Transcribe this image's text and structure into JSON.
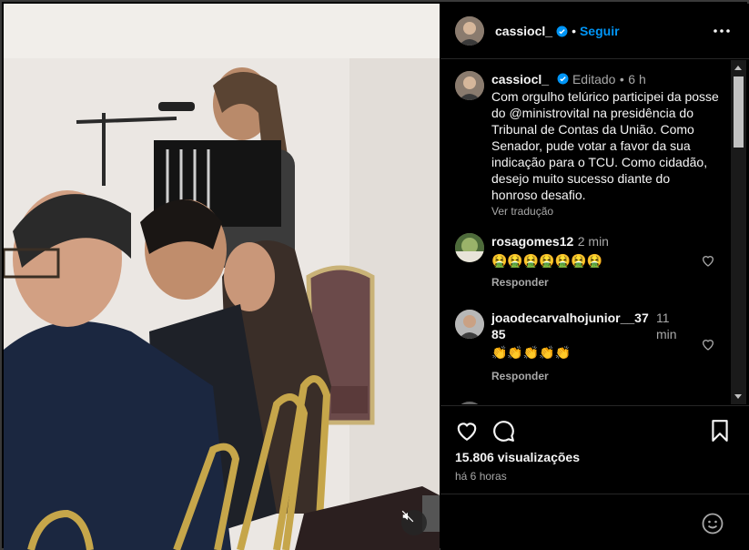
{
  "post": {
    "username": "cassiocl_",
    "follow_label": "Seguir",
    "separator": "•"
  },
  "caption": {
    "username": "cassiocl_",
    "edited_label": "Editado",
    "separator": "•",
    "time": "6 h",
    "text": "Com orgulho telúrico participei da posse do @ministrovital na presidência do Tribunal de Contas da União. Como Senador, pude votar a favor da sua indicação para o TCU. Como cidadão, desejo muito sucesso diante do honroso desafio.",
    "translate_label": "Ver tradução"
  },
  "comments": [
    {
      "username": "rosagomes12",
      "time": "2 min",
      "text": "🤮🤮🤮🤮🤮🤮🤮",
      "reply_label": "Responder"
    },
    {
      "username": "joaodecarvalhojunior__3785",
      "time": "11 min",
      "text": "👏👏👏👏👏",
      "reply_label": "Responder"
    }
  ],
  "stats": {
    "views": "15.806 visualizações",
    "posted": "há 6 horas"
  },
  "colors": {
    "accent": "#0095f6",
    "verified": "#0095f6",
    "background": "#000000",
    "muted_text": "#a8a8a8"
  },
  "icons": {
    "like": "heart-icon",
    "comment": "comment-icon",
    "save": "bookmark-icon",
    "more": "more-icon",
    "mute": "mute-icon",
    "emoji": "emoji-icon"
  }
}
